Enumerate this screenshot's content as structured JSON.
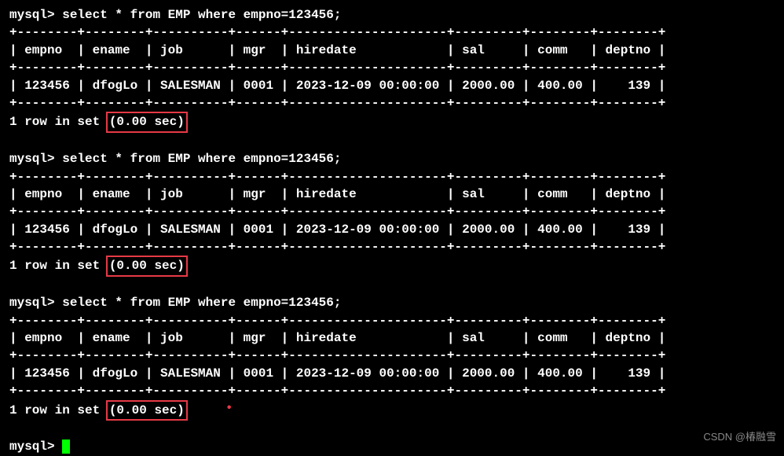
{
  "prompt": "mysql>",
  "query": "select * from EMP where empno=123456;",
  "table_border": "+--------+--------+----------+------+---------------------+---------+--------+--------+",
  "headers_line": "| empno  | ename  | job      | mgr  | hiredate            | sal     | comm   | deptno |",
  "data_line": "| 123456 | dfogLo | SALESMAN | 0001 | 2023-12-09 00:00:00 | 2000.00 | 400.00 |    139 |",
  "status_prefix": "1 row in set ",
  "status_time": "(0.00 sec)",
  "watermark": "CSDN @椿融雪",
  "red_dot": "•"
}
